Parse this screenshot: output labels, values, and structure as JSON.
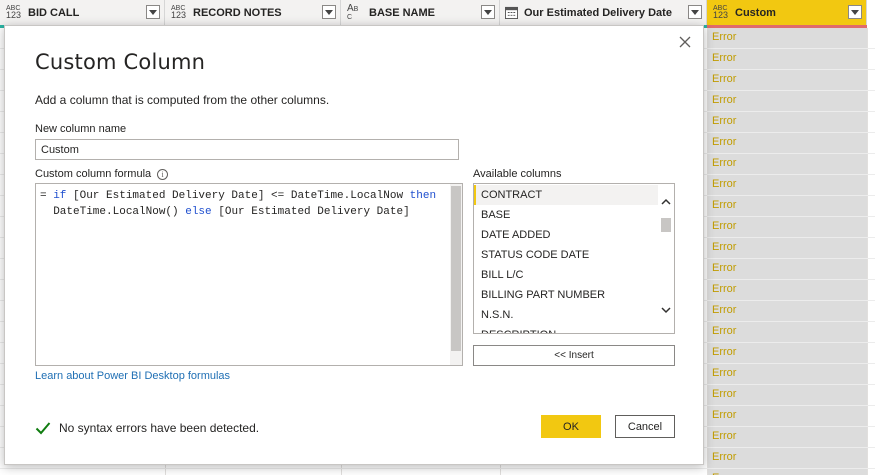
{
  "grid": {
    "columns": [
      {
        "type_top": "ABC",
        "type_bottom": "123",
        "name": "BID CALL"
      },
      {
        "type_top": "ABC",
        "type_bottom": "123",
        "name": "RECORD NOTES"
      },
      {
        "type_top": "A",
        "type_bottom": "B C",
        "name": "BASE NAME"
      },
      {
        "type_top": "",
        "type_bottom": "",
        "name": "Our Estimated Delivery Date"
      },
      {
        "type_top": "ABC",
        "type_bottom": "123",
        "name": "Custom"
      }
    ],
    "custom_values": [
      "Error",
      "Error",
      "Error",
      "Error",
      "Error",
      "Error",
      "Error",
      "Error",
      "Error",
      "Error",
      "Error",
      "Error",
      "Error",
      "Error",
      "Error",
      "Error",
      "Error",
      "Error",
      "Error",
      "Error",
      "Error",
      "Error"
    ]
  },
  "dialog": {
    "title": "Custom Column",
    "description": "Add a column that is computed from the other columns.",
    "name_label": "New column name",
    "name_value": "Custom",
    "formula_label": "Custom column formula",
    "info_glyph": "i",
    "formula": {
      "line1_prefix": "= ",
      "kw_if": "if",
      "line1_mid": " [Our Estimated Delivery Date] <= DateTime.LocalNow ",
      "kw_then": "then",
      "line2_pre": "  DateTime.LocalNow() ",
      "kw_else": "else",
      "line2_post": " [Our Estimated Delivery Date]"
    },
    "learn_link": "Learn about Power BI Desktop formulas",
    "status": "No syntax errors have been detected.",
    "available_label": "Available columns",
    "available_columns": [
      "CONTRACT",
      "BASE",
      "DATE ADDED",
      "STATUS CODE DATE",
      "BILL L/C",
      "BILLING PART NUMBER",
      "N.S.N.",
      "DESCRIPTION"
    ],
    "insert_label": "<< Insert",
    "ok_label": "OK",
    "cancel_label": "Cancel"
  },
  "colors": {
    "accent": "#f2c811",
    "link": "#1f6fb4",
    "keyword": "#1f4fcf",
    "error_text": "#c19c00",
    "success": "#107c10"
  },
  "icons": {
    "close": "close-icon",
    "check": "check-icon",
    "info": "info-icon"
  }
}
